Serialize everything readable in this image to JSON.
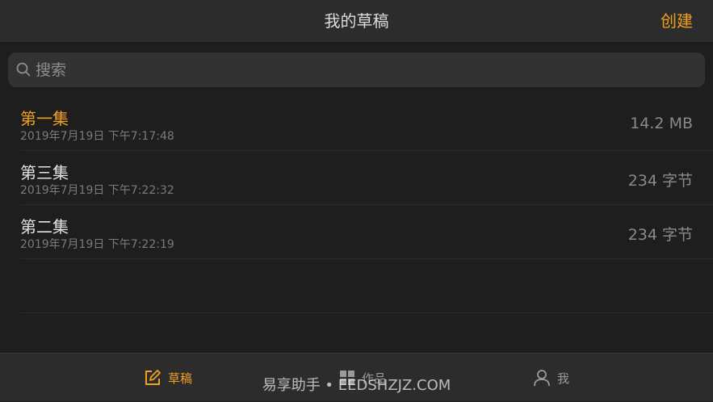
{
  "nav": {
    "title": "我的草稿",
    "create_label": "创建"
  },
  "search": {
    "placeholder": "搜索"
  },
  "drafts": [
    {
      "title": "第一集",
      "date": "2019年7月19日 下午7:17:48",
      "size": "14.2 MB",
      "active": true
    },
    {
      "title": "第三集",
      "date": "2019年7月19日 下午7:22:32",
      "size": "234 字节",
      "active": false
    },
    {
      "title": "第二集",
      "date": "2019年7月19日 下午7:22:19",
      "size": "234 字节",
      "active": false
    }
  ],
  "tabs": [
    {
      "label": "草稿",
      "icon": "edit-icon",
      "active": true
    },
    {
      "label": "作品",
      "icon": "grid-icon",
      "active": false
    },
    {
      "label": "我",
      "icon": "person-icon",
      "active": false
    }
  ],
  "watermark": "易享助手 • EEDSHZJZ.COM",
  "colors": {
    "accent": "#f0a020",
    "background": "#1e1e1e",
    "bar": "#2c2c2c"
  }
}
